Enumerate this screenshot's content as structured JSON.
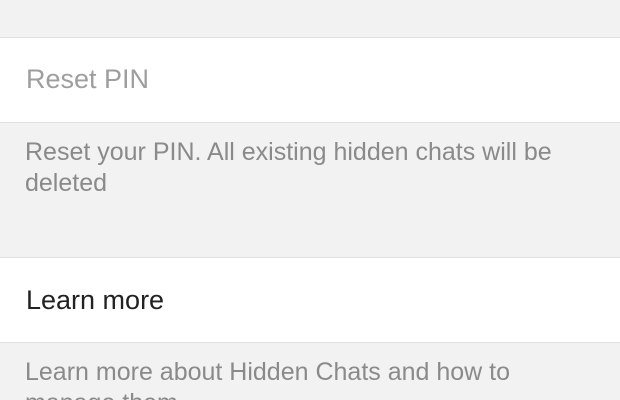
{
  "settings": {
    "reset_pin": {
      "label": "Reset PIN",
      "description": "Reset your PIN. All existing hidden chats will be deleted"
    },
    "learn_more": {
      "label": "Learn more",
      "description": "Learn more about Hidden Chats and how to manage them"
    }
  },
  "colors": {
    "background": "#f2f2f2",
    "row_background": "#ffffff",
    "disabled_text": "#9e9e9e",
    "primary_text": "#222222",
    "secondary_text": "#8a8a8a",
    "separator": "#e0e0e0"
  }
}
